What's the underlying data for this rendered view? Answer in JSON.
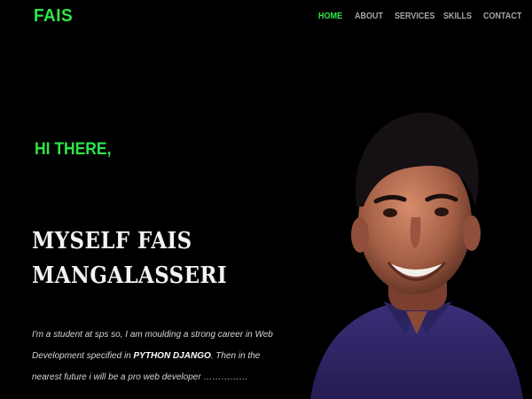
{
  "header": {
    "logo": "FAIS",
    "nav": [
      {
        "label": "HOME"
      },
      {
        "label": "ABOUT"
      },
      {
        "label": "SERVICES"
      },
      {
        "label": "SKILLS"
      },
      {
        "label": "CONTACT"
      }
    ]
  },
  "hero": {
    "greeting": "HI THERE,",
    "headline_line1": "MYSELF FAIS",
    "headline_line2": "MANGALASSERI",
    "about_part1": "I'm a student at sps so, I am moulding a strong career in Web Development specified in ",
    "about_highlight": "PYTHON DJANGO",
    "about_part2": ". Then in the nearest future i will be a pro web developer ……………"
  },
  "colors": {
    "background": "#000000",
    "accent": "#2ee54a",
    "nav_text": "#a6a6a6"
  }
}
